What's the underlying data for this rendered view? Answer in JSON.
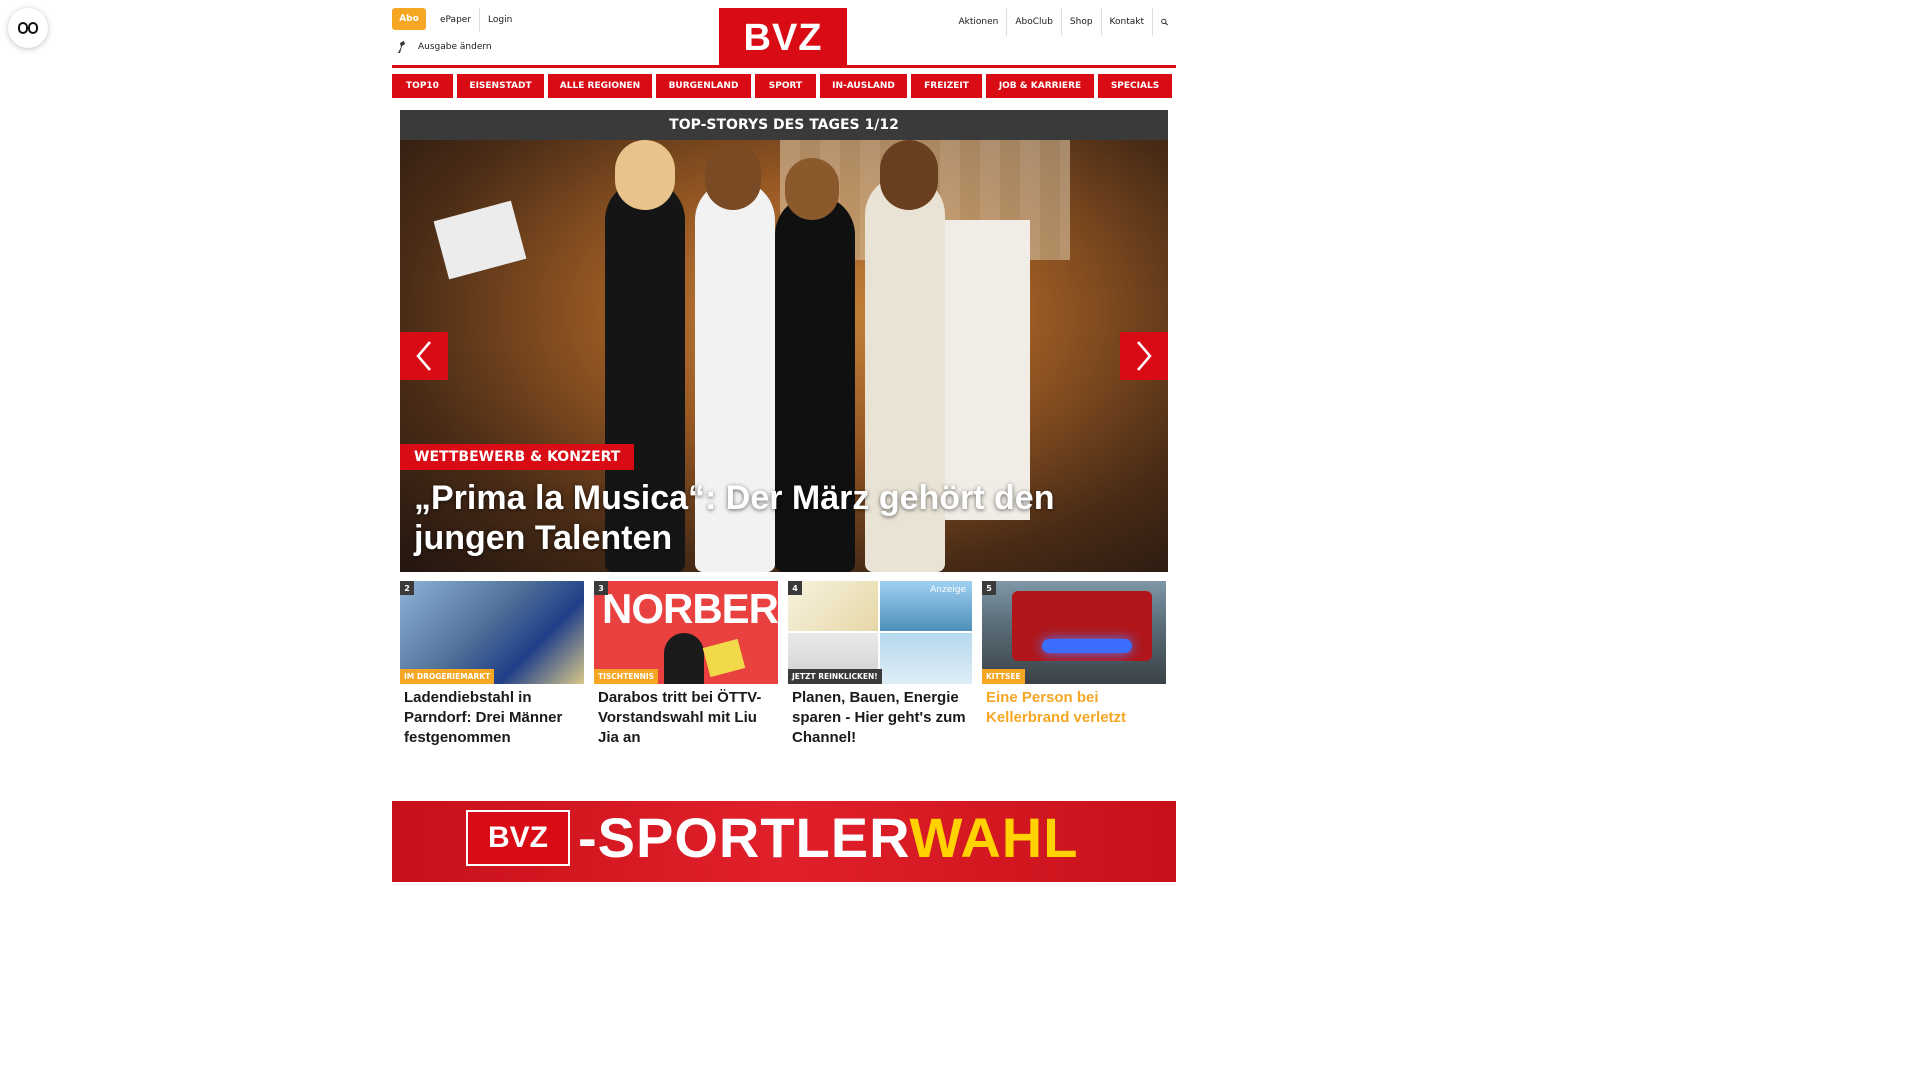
{
  "reader": {
    "icon": "reader-view-icon"
  },
  "header": {
    "abo": "Abo",
    "epaper": "ePaper",
    "login": "Login",
    "ausgabe": "Ausgabe ändern",
    "logo": "BVZ",
    "links": [
      "Aktionen",
      "AboClub",
      "Shop",
      "Kontakt"
    ]
  },
  "nav": [
    "TOP10",
    "EISENSTADT",
    "ALLE REGIONEN",
    "BURGENLAND",
    "SPORT",
    "IN-AUSLAND",
    "FREIZEIT",
    "JOB & KARRIERE",
    "SPECIALS"
  ],
  "hero": {
    "header": "TOP-STORYS DES TAGES 1/12",
    "tag": "WETTBEWERB & KONZERT",
    "title": "„Prima la Musica“: Der März gehört den jungen Talenten"
  },
  "cards": [
    {
      "num": "2",
      "cat": "IM DROGERIEMARKT",
      "title": "Ladendiebstahl in Parndorf: Drei Männer festgenommen"
    },
    {
      "num": "3",
      "cat": "TISCHTENNIS",
      "title": "Darabos tritt bei ÖTTV-Vorstandswahl mit Liu Jia an",
      "img_text": "NORBERT"
    },
    {
      "num": "4",
      "cat": "JETZT REINKLICKEN!",
      "title": "Planen, Bauen, Energie sparen - Hier geht's zum Channel!",
      "anzeige": "Anzeige"
    },
    {
      "num": "5",
      "cat": "KITTSEE",
      "title": "Eine Person bei Kellerbrand verletzt"
    }
  ],
  "sport_banner": {
    "logo": "BVZ",
    "text_white": "-SPORTLER",
    "text_yellow": "WAHL"
  },
  "colors": {
    "brand": "#d90b14",
    "accent": "#f5a623",
    "dark": "#3a3a3a"
  }
}
